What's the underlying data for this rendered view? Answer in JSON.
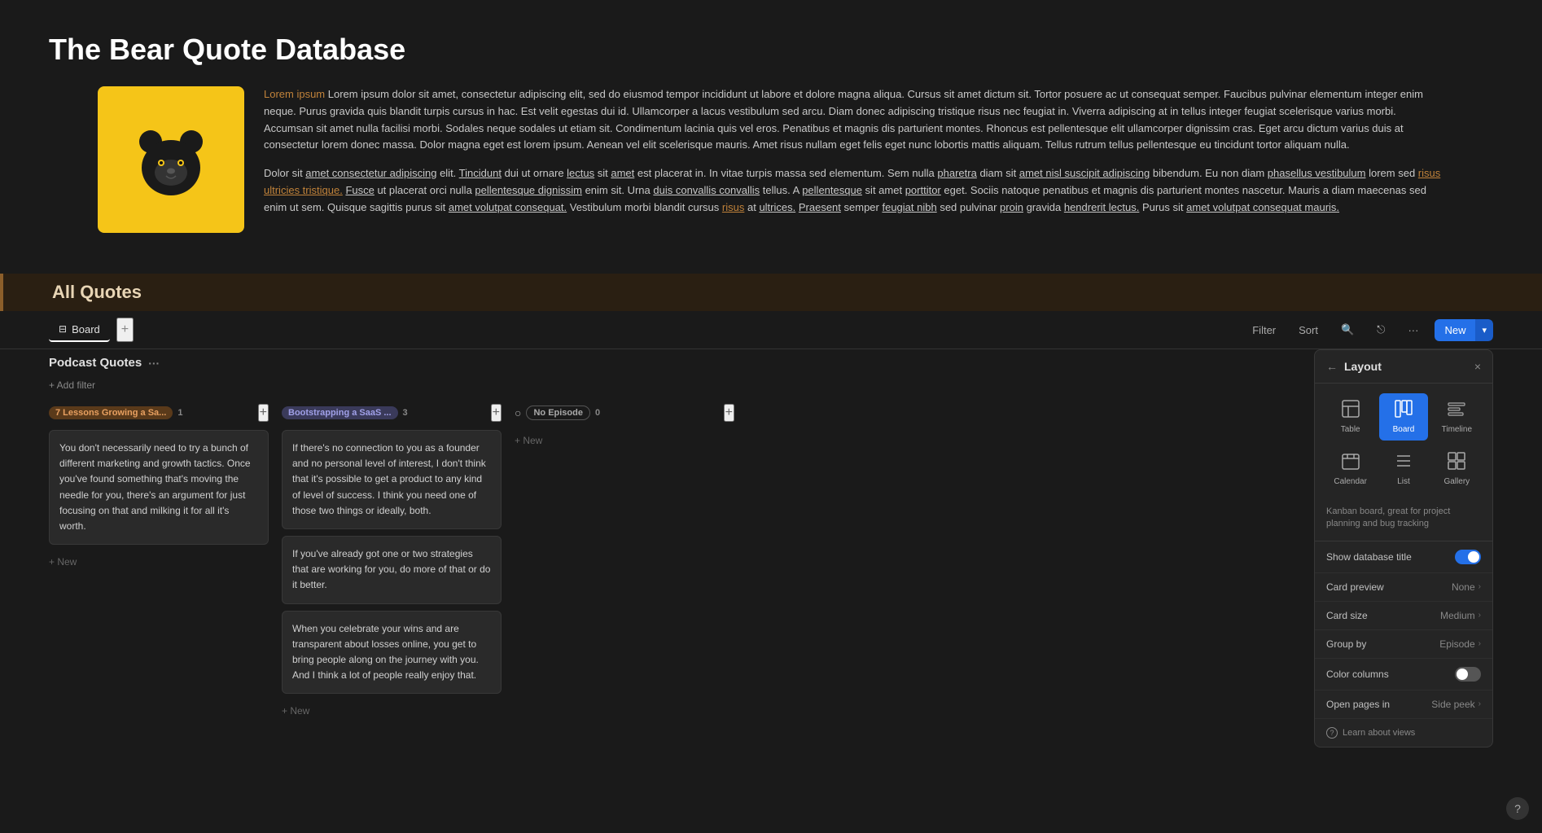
{
  "page": {
    "title": "The Bear Quote Database",
    "logo_alt": "Bear logo",
    "description_p1": "Lorem ipsum dolor sit amet, consectetur adipiscing elit, sed do eiusmod tempor incididunt ut labore et dolore magna aliqua. Cursus sit amet dictum sit. Tortor posuere ac ut consequat semper. Faucibus pulvinar elementum integer enim neque. Purus gravida quis blandit turpis cursus in hac. Est velit egestas dui id. Ullamcorper a lacus vestibulum sed arcu. Diam donec adipiscing tristique risus nec feugiat in. Viverra adipiscing at in tellus integer feugiat scelerisque varius morbi. Accumsan sit amet nulla facilisi morbi. Sodales neque sodales ut etiam sit. Condimentum lacinia quis vel eros. Penatibus et magnis dis parturient montes. Rhoncus est pellentesque elit ullamcorper dignissim cras. Eget arcu dictum varius duis at consectetur lorem donec massa. Dolor magna eget est lorem ipsum. Aenean vel elit scelerisque mauris. Amet risus nullam eget felis eget nunc lobortis mattis aliquam. Tellus rutrum tellus pellentesque eu tincidunt tortor aliquam nulla.",
    "description_p2": "Dolor sit amet consectetur adipiscing elit. Tincidunt dui ut ornare lectus sit amet est placerat in. In vitae turpis massa sed elementum. Sem nulla pharetra diam sit amet nisl suscipit adipiscing bibendum. Eu non diam phasellus vestibulum lorem sed risus ultricies tristique. Fusce ut placerat orci nulla pellentesque dignissim enim sit. Urna duis convallis convallis tellus. A pellentesque sit amet porttitor eget. Sociis natoque penatibus et magnis dis parturient montes nascetur. Mauris a diam maecenas sed enim ut sem. Quisque sagittis purus sit amet volutpat consequat. Vestibulum morbi blandit cursus risus at ultrices. Praesent semper feugiat nibh sed pulvinar proin gravida hendrerit lectus. Purus sit amet volutpat consequat mauris.",
    "section_title": "All Quotes"
  },
  "toolbar": {
    "tab_board_label": "Board",
    "add_tab_label": "+",
    "filter_label": "Filter",
    "sort_label": "Sort",
    "search_placeholder": "Search",
    "more_label": "···",
    "new_label": "New"
  },
  "board": {
    "section_title": "Podcast Quotes",
    "section_menu": "···",
    "add_filter_label": "+ Add filter",
    "columns": [
      {
        "id": "col1",
        "tag": "7 Lessons Growing a Sa...",
        "tag_type": "orange",
        "count": 1,
        "cards": [
          {
            "text": "You don't necessarily need to try a bunch of different marketing and growth tactics. Once you've found something that's moving the needle for you, there's an argument for just focusing on that and milking it for all it's worth."
          }
        ],
        "add_label": "+ New"
      },
      {
        "id": "col2",
        "tag": "Bootstrapping a SaaS ...",
        "tag_type": "blue",
        "count": 3,
        "cards": [
          {
            "text": "If there's no connection to you as a founder and no personal level of interest, I don't think that it's possible to get a product to any kind of level of success. I think you need one of those two things or ideally, both."
          },
          {
            "text": "If you've already got one or two strategies that are working for you, do more of that or do it better."
          },
          {
            "text": "When you celebrate your wins and are transparent about losses online, you get to bring people along on the journey with you. And I think a lot of people really enjoy that."
          }
        ],
        "add_label": "+ New"
      },
      {
        "id": "col3",
        "tag": "No Episode",
        "tag_type": "none",
        "count": 0,
        "cards": [],
        "add_label": "+ New"
      }
    ]
  },
  "layout_panel": {
    "back_icon": "←",
    "title": "Layout",
    "close_icon": "×",
    "options": [
      {
        "id": "table",
        "icon": "⊞",
        "label": "Table",
        "active": false
      },
      {
        "id": "board",
        "icon": "⊟",
        "label": "Board",
        "active": true
      },
      {
        "id": "timeline",
        "icon": "≡",
        "label": "Timeline",
        "active": false
      },
      {
        "id": "calendar",
        "icon": "▦",
        "label": "Calendar",
        "active": false
      },
      {
        "id": "list",
        "icon": "☰",
        "label": "List",
        "active": false
      },
      {
        "id": "gallery",
        "icon": "⊞",
        "label": "Gallery",
        "active": false
      }
    ],
    "description": "Kanban board, great for project planning and bug tracking",
    "rows": [
      {
        "id": "show-title",
        "label": "Show database title",
        "value": "",
        "type": "toggle-on"
      },
      {
        "id": "card-preview",
        "label": "Card preview",
        "value": "None",
        "type": "link"
      },
      {
        "id": "card-size",
        "label": "Card size",
        "value": "Medium",
        "type": "link"
      },
      {
        "id": "group-by",
        "label": "Group by",
        "value": "Episode",
        "type": "link"
      },
      {
        "id": "color-columns",
        "label": "Color columns",
        "value": "",
        "type": "toggle-off"
      },
      {
        "id": "open-pages-in",
        "label": "Open pages in",
        "value": "Side peek",
        "type": "link"
      }
    ],
    "learn_label": "Learn about views"
  },
  "help": {
    "label": "?"
  }
}
